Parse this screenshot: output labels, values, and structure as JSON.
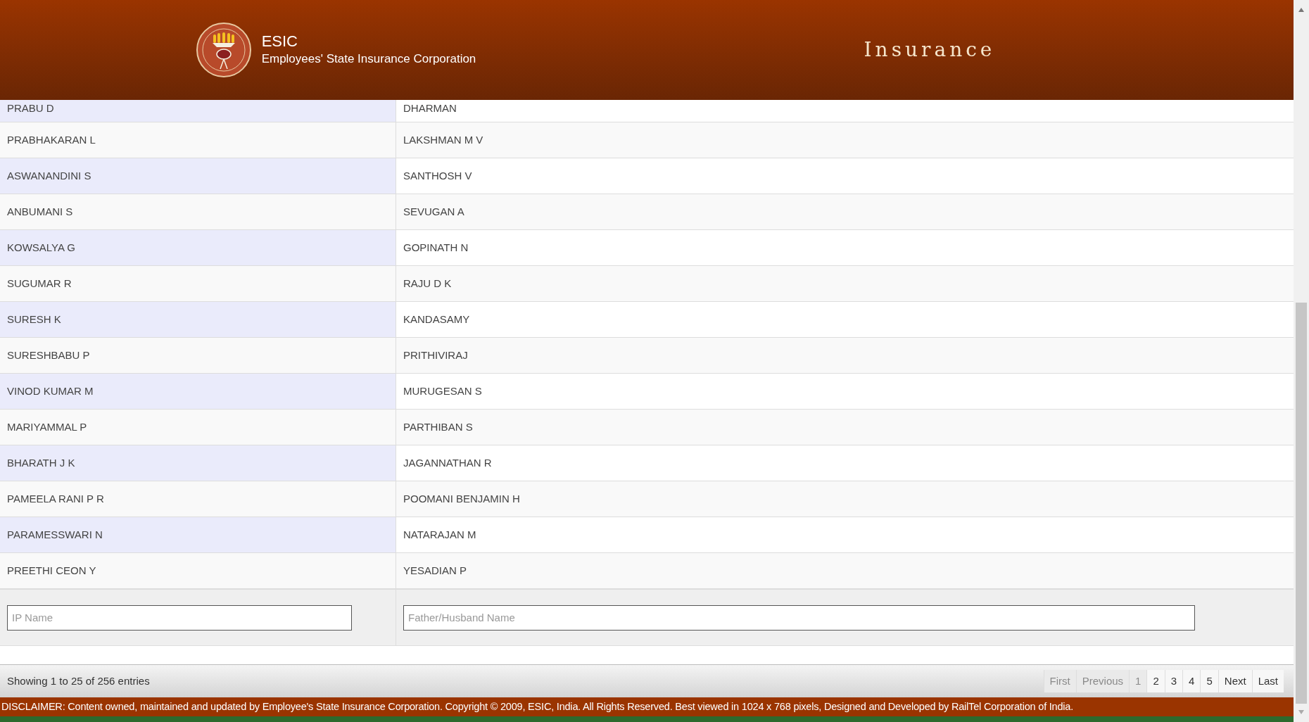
{
  "header": {
    "logo_title": "ESIC",
    "logo_subtitle": "Employees' State Insurance Corporation",
    "section_title": "Insurance"
  },
  "table": {
    "rows": [
      {
        "ip_name": "PRABU D",
        "father_husband_name": "DHARMAN"
      },
      {
        "ip_name": "PRABHAKARAN L",
        "father_husband_name": "LAKSHMAN M V"
      },
      {
        "ip_name": "ASWANANDINI S",
        "father_husband_name": "SANTHOSH V"
      },
      {
        "ip_name": "ANBUMANI S",
        "father_husband_name": "SEVUGAN A"
      },
      {
        "ip_name": "KOWSALYA G",
        "father_husband_name": "GOPINATH N"
      },
      {
        "ip_name": "SUGUMAR R",
        "father_husband_name": "RAJU D K"
      },
      {
        "ip_name": "SURESH K",
        "father_husband_name": "KANDASAMY"
      },
      {
        "ip_name": "SURESHBABU P",
        "father_husband_name": "PRITHIVIRAJ"
      },
      {
        "ip_name": "VINOD KUMAR M",
        "father_husband_name": "MURUGESAN S"
      },
      {
        "ip_name": "MARIYAMMAL P",
        "father_husband_name": "PARTHIBAN S"
      },
      {
        "ip_name": "BHARATH J K",
        "father_husband_name": "JAGANNATHAN R"
      },
      {
        "ip_name": "PAMEELA RANI P R",
        "father_husband_name": "POOMANI BENJAMIN H"
      },
      {
        "ip_name": "PARAMESSWARI N",
        "father_husband_name": "NATARAJAN M"
      },
      {
        "ip_name": "PREETHI CEON Y",
        "father_husband_name": "YESADIAN P"
      }
    ],
    "filters": [
      {
        "placeholder": "IP Name"
      },
      {
        "placeholder": "Father/Husband Name"
      }
    ]
  },
  "info": "Showing 1 to 25 of 256 entries",
  "pagination": [
    {
      "label": "First",
      "kind": "nav",
      "disabled": true
    },
    {
      "label": "Previous",
      "kind": "nav",
      "disabled": true
    },
    {
      "label": "1",
      "kind": "page",
      "selected": true
    },
    {
      "label": "2",
      "kind": "page",
      "selected": false
    },
    {
      "label": "3",
      "kind": "page",
      "selected": false
    },
    {
      "label": "4",
      "kind": "page",
      "selected": false
    },
    {
      "label": "5",
      "kind": "page",
      "selected": false
    },
    {
      "label": "Next",
      "kind": "nav",
      "disabled": false
    },
    {
      "label": "Last",
      "kind": "nav",
      "disabled": false
    }
  ],
  "disclaimer": "DISCLAIMER: Content owned, maintained and updated by Employee's State Insurance Corporation. Copyright © 2009, ESIC, India. All Rights Reserved. Best viewed in 1024 x 768 pixels, Designed and Developed by RailTel Corporation of India."
}
